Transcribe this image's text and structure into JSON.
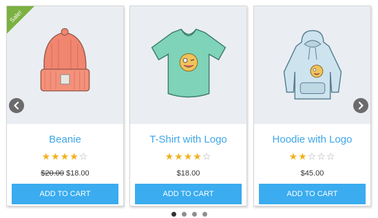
{
  "carousel": {
    "products": [
      {
        "title": "Beanie",
        "rating": 4,
        "rating_max": 5,
        "old_price": "$20.00",
        "price": "$18.00",
        "button": "ADD TO CART",
        "badge": "Sale!",
        "image_icon": "beanie-icon"
      },
      {
        "title": "T-Shirt with Logo",
        "rating": 4,
        "rating_max": 5,
        "price": "$18.00",
        "button": "ADD TO CART",
        "image_icon": "tshirt-icon"
      },
      {
        "title": "Hoodie with Logo",
        "rating": 2,
        "rating_max": 5,
        "price": "$45.00",
        "button": "ADD TO CART",
        "image_icon": "hoodie-icon"
      }
    ],
    "nav": {
      "prev_icon": "chevron-left-icon",
      "next_icon": "chevron-right-icon"
    },
    "pagination": {
      "pages": 4,
      "active_page": 1
    }
  },
  "colors": {
    "accent": "#3aacef",
    "title": "#3ea6e8",
    "sale_badge": "#7bb141",
    "star": "#f2b01e",
    "image_bg": "#eaeef2"
  }
}
